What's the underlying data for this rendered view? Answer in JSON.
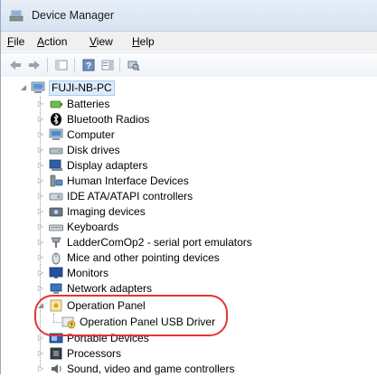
{
  "window": {
    "title": "Device Manager"
  },
  "menu": [
    {
      "label": "File",
      "underline": "F",
      "rest": "ile"
    },
    {
      "label": "Action",
      "underline": "A",
      "rest": "ction"
    },
    {
      "label": "View",
      "underline": "V",
      "rest": "iew"
    },
    {
      "label": "Help",
      "underline": "H",
      "rest": "elp"
    }
  ],
  "toolbar": {
    "buttons": [
      "back-arrow-icon",
      "forward-arrow-icon",
      "show-hide-tree-icon",
      "help-icon",
      "properties-icon",
      "scan-hardware-icon"
    ]
  },
  "tree": {
    "root": "FUJI-NB-PC",
    "items": [
      {
        "label": "Batteries",
        "icon": "battery-icon"
      },
      {
        "label": "Bluetooth Radios",
        "icon": "bluetooth-icon"
      },
      {
        "label": "Computer",
        "icon": "computer-icon"
      },
      {
        "label": "Disk drives",
        "icon": "disk-drive-icon"
      },
      {
        "label": "Display adapters",
        "icon": "display-adapter-icon"
      },
      {
        "label": "Human Interface Devices",
        "icon": "hid-icon"
      },
      {
        "label": "IDE ATA/ATAPI controllers",
        "icon": "ide-controller-icon"
      },
      {
        "label": "Imaging devices",
        "icon": "camera-icon"
      },
      {
        "label": "Keyboards",
        "icon": "keyboard-icon"
      },
      {
        "label": "LadderComOp2 - serial port emulators",
        "icon": "serial-port-icon"
      },
      {
        "label": "Mice and other pointing devices",
        "icon": "mouse-icon"
      },
      {
        "label": "Monitors",
        "icon": "monitor-icon"
      },
      {
        "label": "Network adapters",
        "icon": "network-adapter-icon"
      },
      {
        "label": "Operation Panel",
        "icon": "operation-panel-icon",
        "expanded": true
      },
      {
        "label": "Operation Panel USB Driver",
        "icon": "unknown-device-icon",
        "child": true
      },
      {
        "label": "Portable Devices",
        "icon": "portable-device-icon"
      },
      {
        "label": "Processors",
        "icon": "processor-icon"
      },
      {
        "label": "Sound, video and game controllers",
        "icon": "sound-icon"
      }
    ]
  },
  "colors": {
    "highlight": "#e53434",
    "selection": "#dcebfc"
  }
}
